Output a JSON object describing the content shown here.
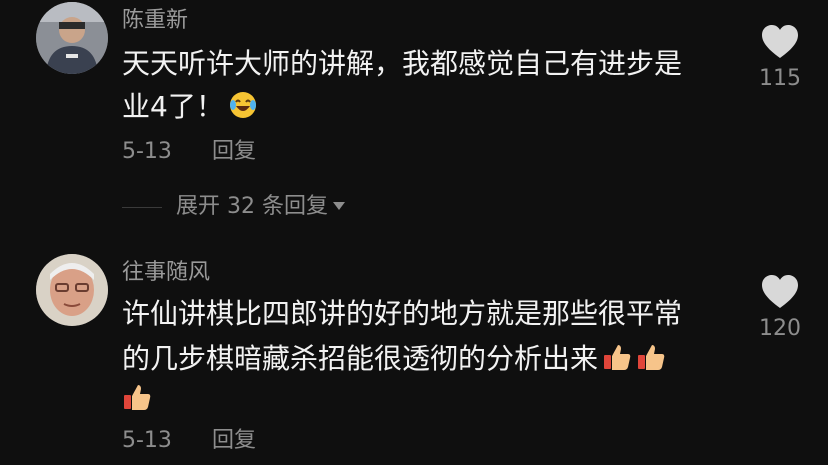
{
  "comments": [
    {
      "username": "陈重新",
      "text_line1": "天天听许大师的讲解，我都感觉自己有进步是",
      "text_line2": "业4了！",
      "emoji_icon": "laughing-tears-emoji",
      "date": "5-13",
      "reply_label": "回复",
      "like_count": "115"
    },
    {
      "username": "往事随风",
      "text_line1": "许仙讲棋比四郎讲的好的地方就是那些很平常",
      "text_line2": "的几步棋暗藏杀招能很透彻的分析出来",
      "emoji_icon": "thumbs-up-emoji",
      "date": "5-13",
      "reply_label": "回复",
      "like_count": "120"
    }
  ],
  "expand_replies_label": "展开 32 条回复",
  "colors": {
    "background": "#0f0f0f",
    "text": "#f2f2f2",
    "secondary": "#8d8d8d",
    "like_icon": "#d8d8d8"
  }
}
